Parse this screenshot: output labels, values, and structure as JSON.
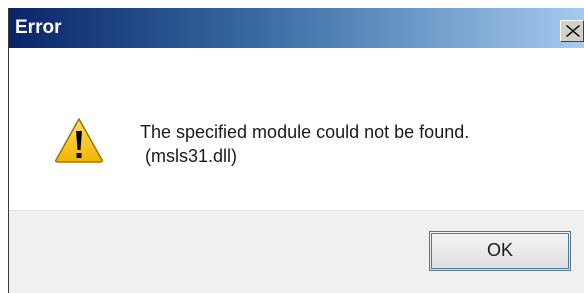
{
  "window": {
    "title": "Error",
    "close_glyph": "close-icon"
  },
  "message": {
    "line1": "The specified module could not be found.",
    "line2": " (msls31.dll)",
    "icon": "warning-icon"
  },
  "buttons": {
    "ok_label": "OK"
  },
  "colors": {
    "titlebar_start": "#0a246a",
    "titlebar_end": "#a6caf0",
    "warning_yellow": "#f5c400"
  }
}
